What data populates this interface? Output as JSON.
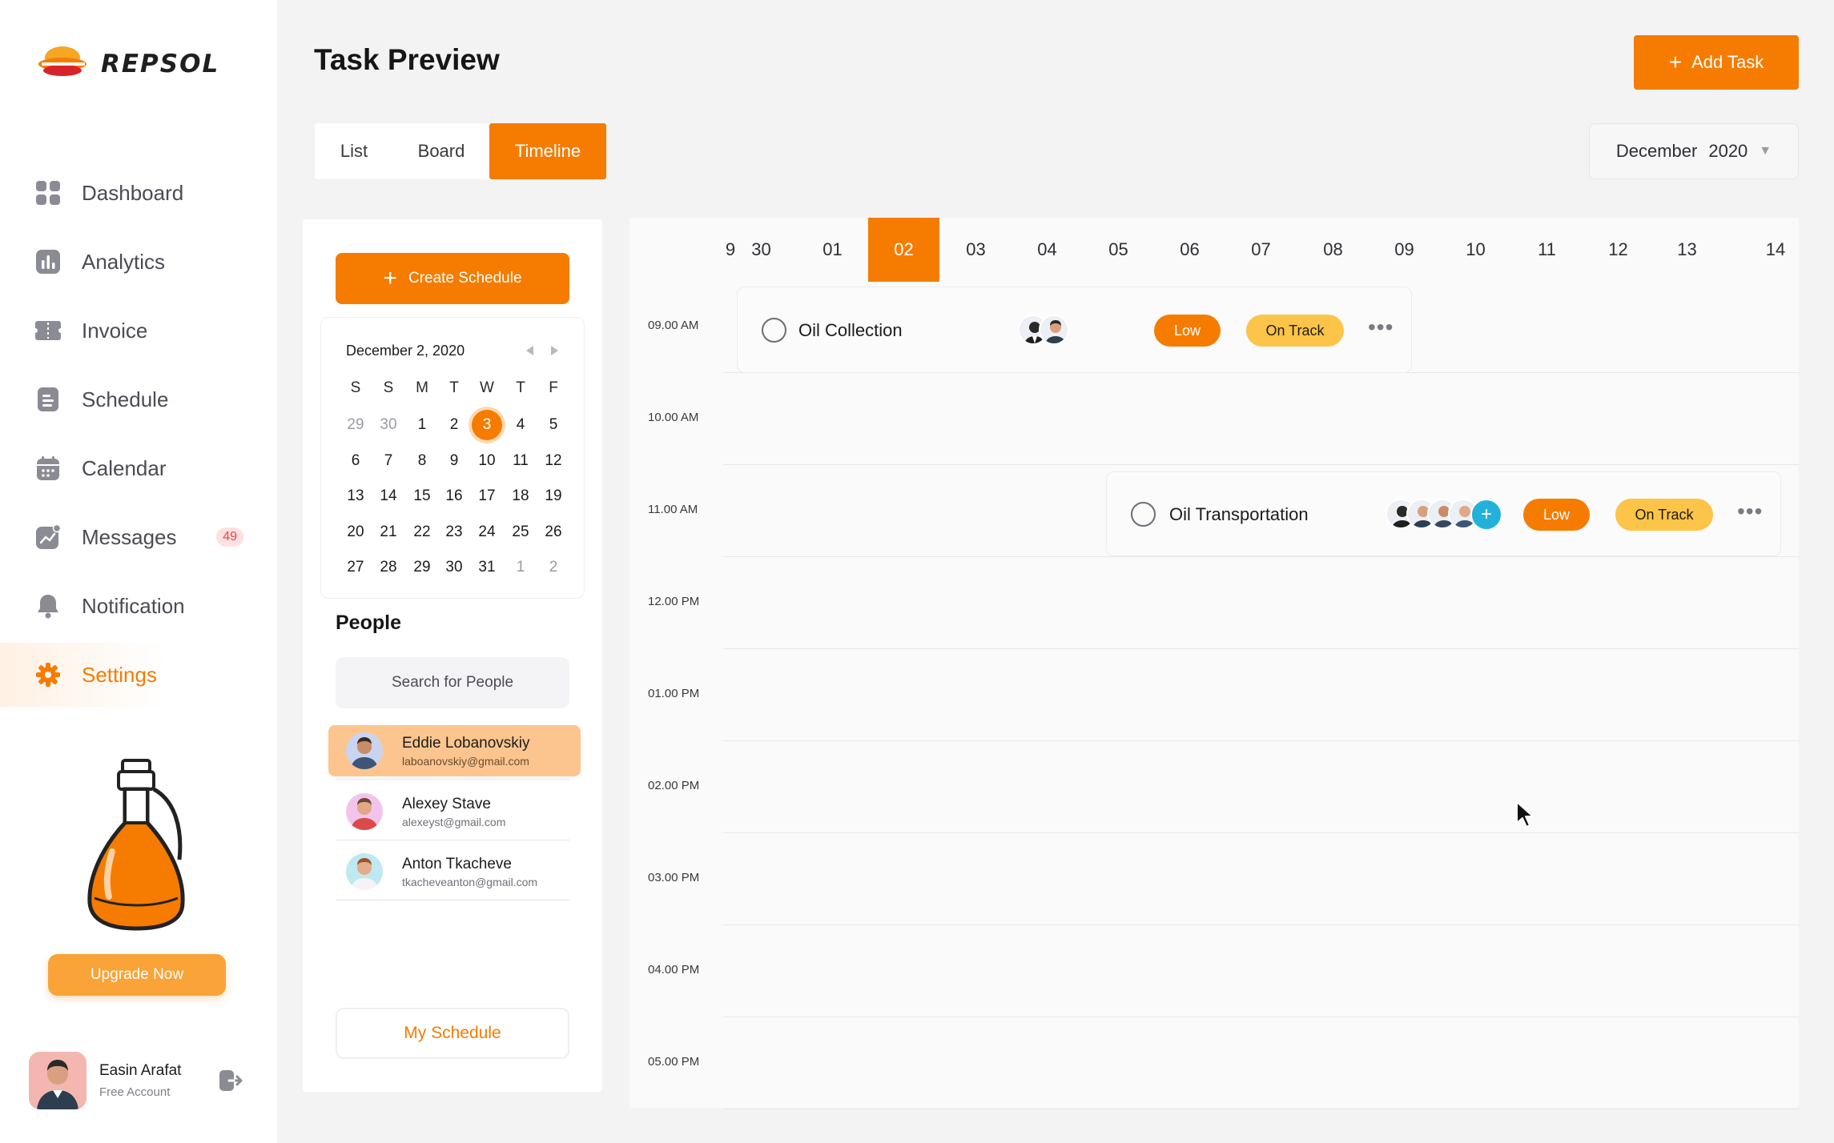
{
  "brand": {
    "name": "REPSOL"
  },
  "sidebar": {
    "items": [
      {
        "label": "Dashboard",
        "icon": "grid-icon"
      },
      {
        "label": "Analytics",
        "icon": "bar-chart-icon"
      },
      {
        "label": "Invoice",
        "icon": "ticket-icon"
      },
      {
        "label": "Schedule",
        "icon": "document-icon"
      },
      {
        "label": "Calendar",
        "icon": "calendar-icon"
      },
      {
        "label": "Messages",
        "icon": "trend-icon",
        "badge": "49"
      },
      {
        "label": "Notification",
        "icon": "bell-icon"
      },
      {
        "label": "Settings",
        "icon": "gear-icon",
        "active": true
      }
    ],
    "upgrade_label": "Upgrade Now",
    "user": {
      "name": "Easin Arafat",
      "plan": "Free Account"
    }
  },
  "header": {
    "title": "Task Preview",
    "add_task_label": "Add Task",
    "tabs": [
      {
        "label": "List"
      },
      {
        "label": "Board"
      },
      {
        "label": "Timeline",
        "active": true
      }
    ],
    "month_select": {
      "month": "December",
      "year": "2020"
    }
  },
  "left_panel": {
    "create_schedule_label": "Create Schedule",
    "calendar": {
      "title": "December 2, 2020",
      "weekdays": [
        "S",
        "S",
        "M",
        "T",
        "W",
        "T",
        "F"
      ],
      "weeks": [
        [
          "29",
          "30",
          "1",
          "2",
          "3",
          "4",
          "5"
        ],
        [
          "6",
          "7",
          "8",
          "9",
          "10",
          "11",
          "12"
        ],
        [
          "13",
          "14",
          "15",
          "16",
          "17",
          "18",
          "19"
        ],
        [
          "20",
          "21",
          "22",
          "23",
          "24",
          "25",
          "26"
        ],
        [
          "27",
          "28",
          "29",
          "30",
          "31",
          "1",
          "2"
        ]
      ],
      "selected": "3"
    },
    "people_title": "People",
    "search_placeholder": "Search for People",
    "people": [
      {
        "name": "Eddie Lobanovskiy",
        "email": "laboanovskiy@gmail.com",
        "active": true
      },
      {
        "name": "Alexey Stave",
        "email": "alexeyst@gmail.com"
      },
      {
        "name": "Anton Tkacheve",
        "email": "tkacheveanton@gmail.com"
      }
    ],
    "my_schedule_label": "My Schedule"
  },
  "timeline": {
    "days": [
      "9",
      "30",
      "01",
      "02",
      "03",
      "04",
      "05",
      "06",
      "07",
      "08",
      "09",
      "10",
      "11",
      "12",
      "13",
      "14"
    ],
    "active_day": "02",
    "times": [
      "09.00 AM",
      "10.00 AM",
      "11.00 AM",
      "12.00 PM",
      "01.00 PM",
      "02.00 PM",
      "03.00 PM",
      "04.00 PM",
      "05.00 PM"
    ],
    "tasks": [
      {
        "name": "Oil Collection",
        "priority": "Low",
        "status": "On Track"
      },
      {
        "name": "Oil Transportation",
        "priority": "Low",
        "status": "On Track"
      }
    ]
  },
  "colors": {
    "accent": "#f57c00",
    "accent_light": "#fcc590",
    "status_yellow": "#fcc448",
    "avatar_add": "#22b2d9"
  }
}
